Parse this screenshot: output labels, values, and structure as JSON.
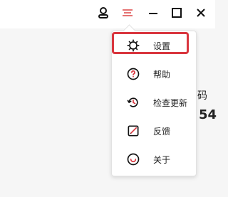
{
  "menu": {
    "items": [
      {
        "label": "设置",
        "icon": "gear-icon"
      },
      {
        "label": "帮助",
        "icon": "help-icon"
      },
      {
        "label": "检查更新",
        "icon": "refresh-icon"
      },
      {
        "label": "反馈",
        "icon": "feedback-icon"
      },
      {
        "label": "关于",
        "icon": "about-icon"
      }
    ]
  },
  "background": {
    "partial_text_1": "码",
    "partial_text_2": "54"
  },
  "colors": {
    "accent": "#d9363e",
    "menu_toggle": "#e57373"
  }
}
